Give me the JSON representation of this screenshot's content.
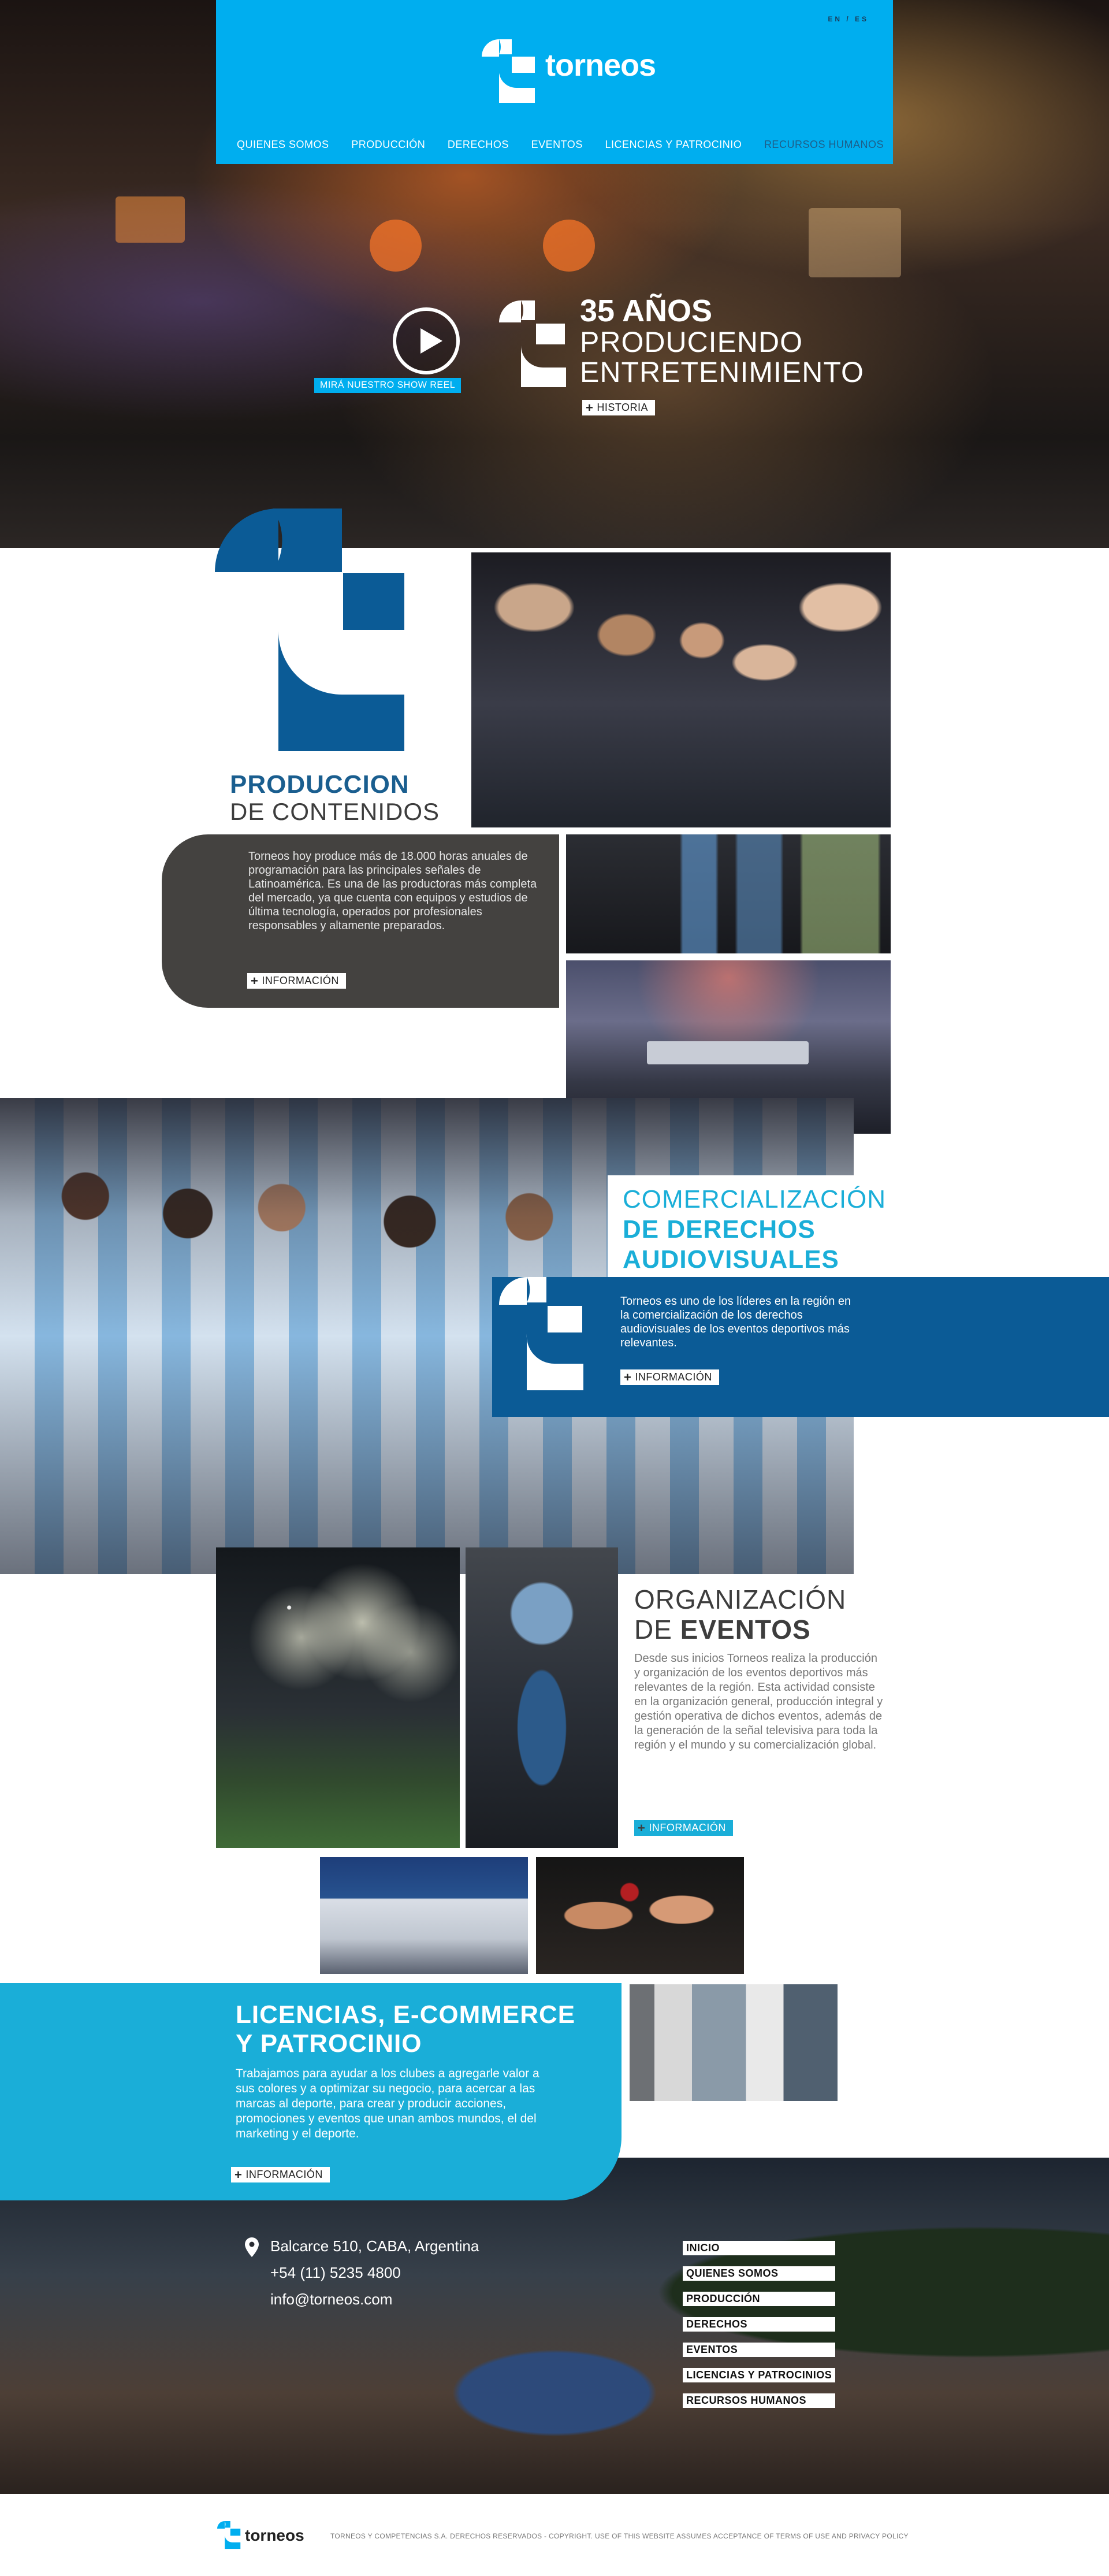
{
  "header": {
    "lang": "EN / ES",
    "logo_text": "torneos",
    "nav": [
      {
        "label": "QUIENES SOMOS"
      },
      {
        "label": "PRODUCCIÓN"
      },
      {
        "label": "DERECHOS"
      },
      {
        "label": "EVENTOS"
      },
      {
        "label": "LICENCIAS Y PATROCINIO"
      },
      {
        "label": "RECURSOS HUMANOS"
      }
    ]
  },
  "hero": {
    "reel_label": "MIRÁ NUESTRO SHOW REEL",
    "title_line1": "35 AÑOS",
    "title_line2": "PRODUCIENDO",
    "title_line3": "ENTRETENIMIENTO",
    "history_button": "HISTORIA"
  },
  "produccion": {
    "title_line1": "PRODUCCION",
    "title_line2": "DE CONTENIDOS",
    "text": "Torneos hoy produce más de 18.000 horas anuales de programación para las principales señales de Latinoamérica. Es una de las productoras más completa del mercado, ya que cuenta con equipos y estudios de última tecnología, operados por profesionales responsables y altamente preparados.",
    "button": "INFORMACIÓN"
  },
  "comercializacion": {
    "title_line1": "COMERCIALIZACIÓN",
    "title_line2": "DE DERECHOS",
    "title_line3": "AUDIOVISUALES",
    "text": "Torneos es uno de los líderes en la región en la comercialización de los derechos audiovisuales de los eventos deportivos más relevantes.",
    "button": "INFORMACIÓN"
  },
  "eventos": {
    "title_line1": "ORGANIZACIÓN",
    "title_line2": "DE",
    "title_bold": "EVENTOS",
    "text": "Desde sus inicios Torneos realiza la producción y organización de los eventos deportivos más relevantes de la región. Esta actividad consiste en la organización general, producción integral y gestión operativa de dichos eventos, además de la generación de la señal televisiva para toda la región y el mundo y su comercialización global.",
    "button": "INFORMACIÓN"
  },
  "licencias": {
    "title_line1": "LICENCIAS, E-COMMERCE",
    "title_line2": "Y PATROCINIO",
    "text": "Trabajamos para ayudar a los clubes a agregarle valor a sus colores y a optimizar su negocio, para acercar a las marcas al deporte, para crear y producir acciones, promociones y eventos que unan ambos mundos, el del marketing y el deporte.",
    "button": "INFORMACIÓN"
  },
  "contact": {
    "address": "Balcarce 510, CABA, Argentina",
    "phone": "+54 (11) 5235 4800",
    "email": "info@torneos.com"
  },
  "footer_menu": [
    {
      "label": "INICIO"
    },
    {
      "label": "QUIENES SOMOS"
    },
    {
      "label": "PRODUCCIÓN"
    },
    {
      "label": "DERECHOS"
    },
    {
      "label": "EVENTOS"
    },
    {
      "label": "LICENCIAS Y PATROCINIOS"
    },
    {
      "label": "RECURSOS HUMANOS"
    }
  ],
  "bottom": {
    "logo_text": "torneos",
    "copyright": "TORNEOS Y COMPETENCIAS S.A. DERECHOS RESERVADOS - COPYRIGHT. USE OF THIS WEBSITE ASSUMES ACCEPTANCE OF TERMS OF USE AND PRIVACY POLICY"
  },
  "colors": {
    "brand_cyan": "#00aeef",
    "brand_navy": "#0b5b96",
    "dark_gray": "#444240",
    "accent_cyan": "#1aaed8"
  }
}
